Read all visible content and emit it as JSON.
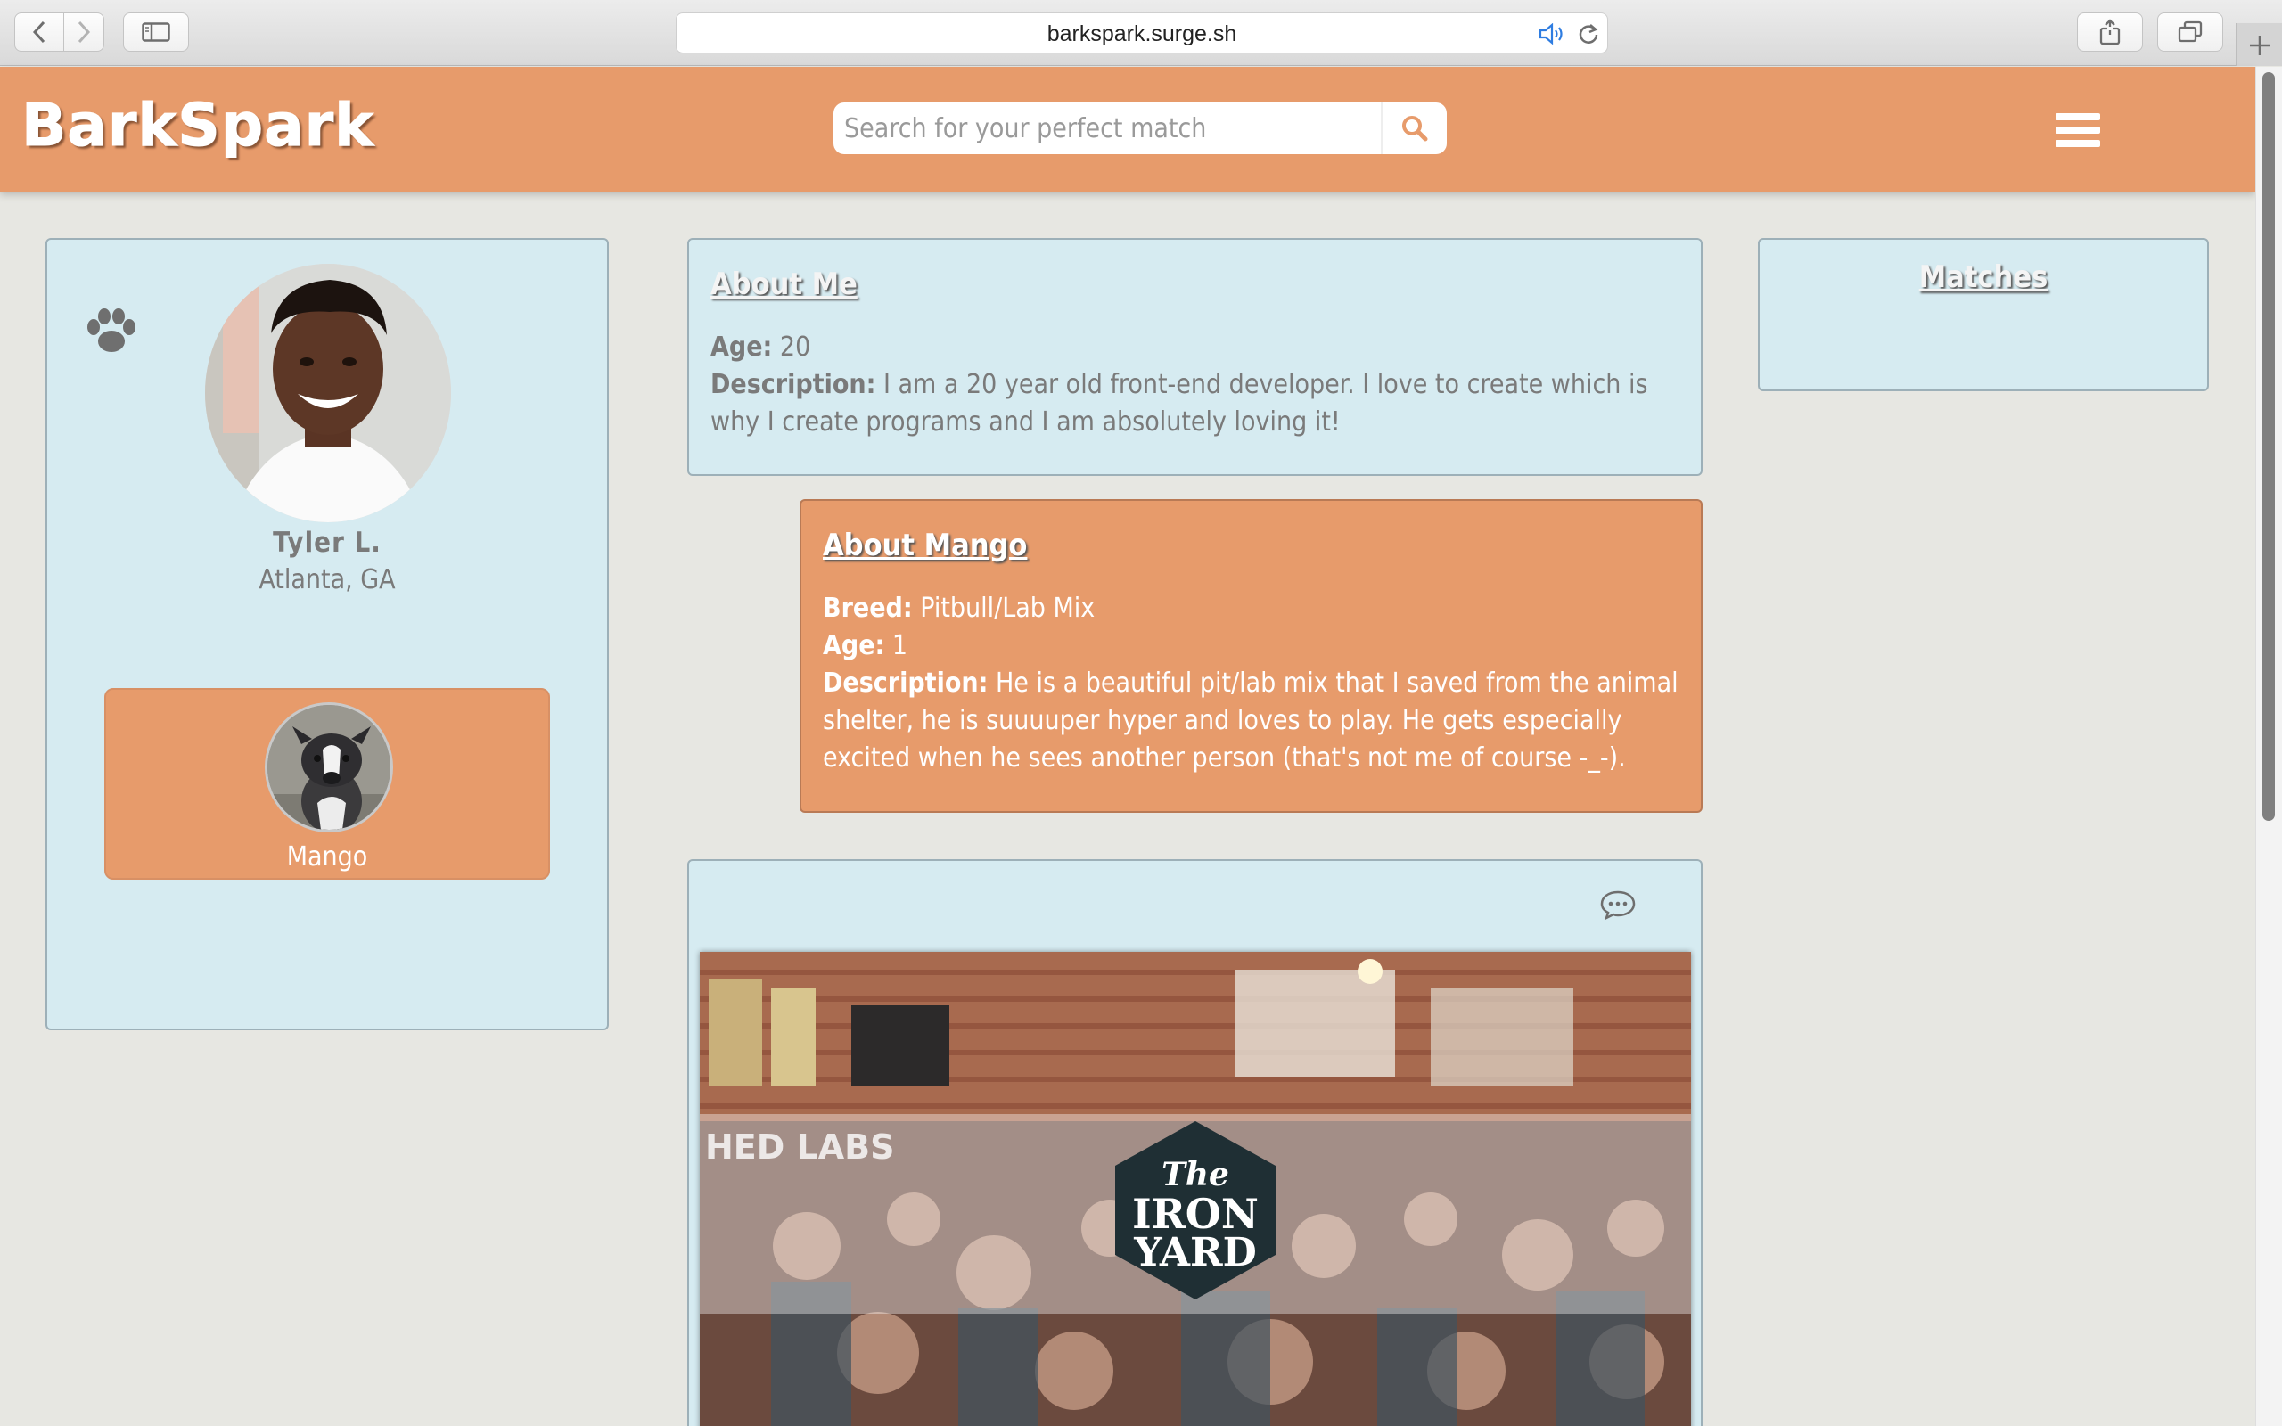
{
  "browser": {
    "url": "barkspark.surge.sh"
  },
  "header": {
    "logo": "BarkSpark",
    "search_placeholder": "Search for your perfect match"
  },
  "profile": {
    "name": "Tyler L.",
    "location": "Atlanta, GA",
    "pet_card": {
      "name": "Mango"
    }
  },
  "about_me": {
    "title": "About Me",
    "age_label": "Age:",
    "age": "20",
    "description_label": "Description:",
    "description": "I am a 20 year old front-end developer. I love to create which is why I create programs and I am absolutely loving it!"
  },
  "about_pet": {
    "title": "About Mango",
    "breed_label": "Breed:",
    "breed": "Pitbull/Lab Mix",
    "age_label": "Age:",
    "age": "1",
    "description_label": "Description:",
    "description": "He is a beautiful pit/lab mix that I saved from the animal shelter, he is suuuuper hyper and loves to play. He gets especially excited when he sees another person (that's not me of course -_-)."
  },
  "matches": {
    "title": "Matches"
  },
  "feed": {
    "logo_line1": "The",
    "logo_line2": "IRON",
    "logo_line3": "YARD",
    "sign_text": "HED LABS"
  },
  "colors": {
    "header_orange": "#e79b6b",
    "panel_blue": "#d6ebf1",
    "page_bg": "#e7e7e2"
  },
  "icons": [
    "back-arrow-icon",
    "forward-arrow-icon",
    "sidebar-icon",
    "speaker-icon",
    "reload-icon",
    "share-icon",
    "tabs-icon",
    "plus-icon",
    "search-icon",
    "hamburger-menu-icon",
    "paw-icon",
    "chat-bubble-icon"
  ]
}
